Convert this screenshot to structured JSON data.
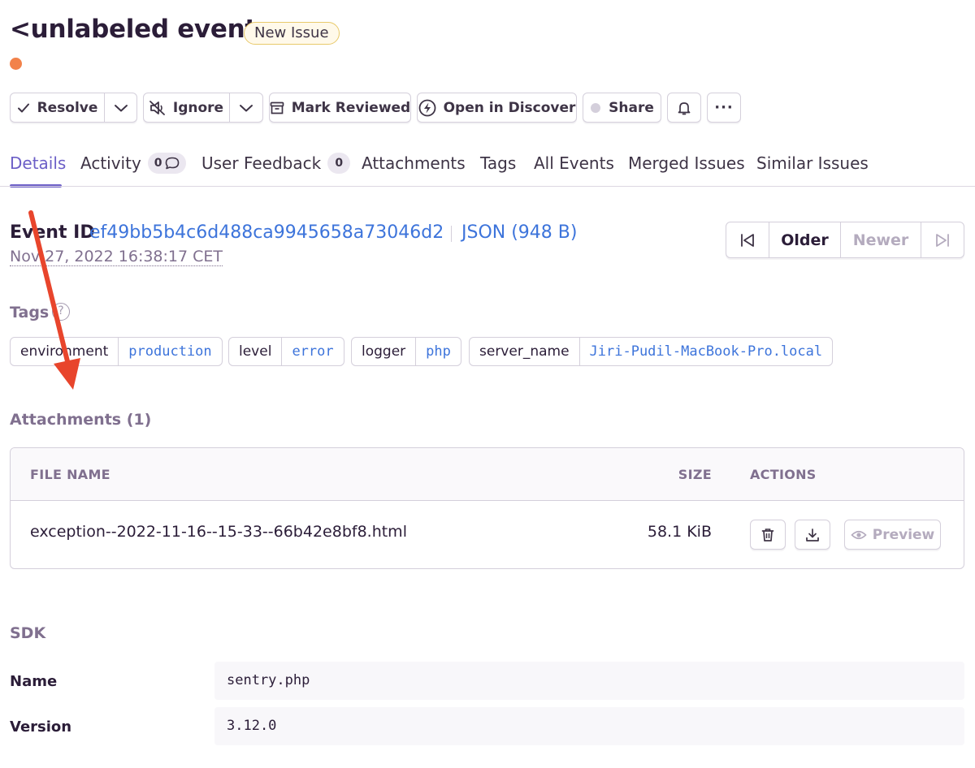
{
  "header": {
    "title": "<unlabeled event>",
    "badge": "New Issue"
  },
  "toolbar": {
    "resolve": "Resolve",
    "ignore": "Ignore",
    "mark_reviewed": "Mark Reviewed",
    "open_in_discover": "Open in Discover",
    "share": "Share",
    "more": "···"
  },
  "tabs": {
    "details": "Details",
    "activity": "Activity",
    "activity_count": "0",
    "user_feedback": "User Feedback",
    "user_feedback_count": "0",
    "attachments": "Attachments",
    "tags": "Tags",
    "all_events": "All Events",
    "merged_issues": "Merged Issues",
    "similar_issues": "Similar Issues"
  },
  "event": {
    "label": "Event ID",
    "id": "ef49bb5b4c6d488ca9945658a73046d2",
    "json": "JSON (948 B)",
    "date": "Nov 27, 2022 16:38:17 CET"
  },
  "pager": {
    "older": "Older",
    "newer": "Newer"
  },
  "tags_section": {
    "title": "Tags",
    "help": "?",
    "items": [
      {
        "key": "environment",
        "value": "production"
      },
      {
        "key": "level",
        "value": "error"
      },
      {
        "key": "logger",
        "value": "php"
      },
      {
        "key": "server_name",
        "value": "Jiri-Pudil-MacBook-Pro.local"
      }
    ]
  },
  "attachments": {
    "title": "Attachments (1)",
    "columns": {
      "file_name": "FILE NAME",
      "size": "SIZE",
      "actions": "ACTIONS"
    },
    "rows": [
      {
        "file_name": "exception--2022-11-16--15-33--66b42e8bf8.html",
        "size": "58.1 KiB",
        "preview": "Preview"
      }
    ]
  },
  "sdk": {
    "title": "SDK",
    "name_label": "Name",
    "name_value": "sentry.php",
    "version_label": "Version",
    "version_value": "3.12.0"
  },
  "colors": {
    "accent": "#6c5fc7",
    "link": "#3d74db",
    "status_dot": "#f2824a",
    "annotation_arrow": "#e8452c"
  }
}
